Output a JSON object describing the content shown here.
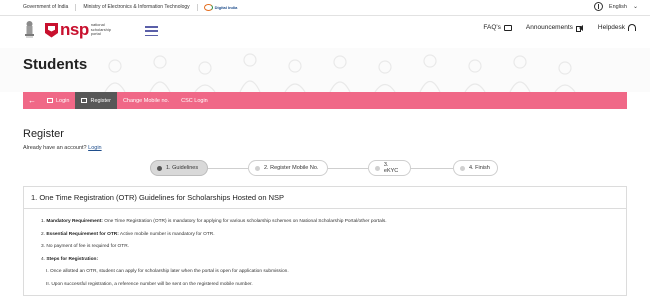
{
  "gov_strip": {
    "government": "Government of India",
    "ministry": "Ministry of Electronics & Information Technology",
    "digital_india": "Digital India",
    "language": "English"
  },
  "header": {
    "logo_text": "nsp",
    "logo_sub": "national scholarship portal",
    "nav": [
      {
        "label": "FAQ's",
        "icon": "chat-icon"
      },
      {
        "label": "Announcements",
        "icon": "megaphone-icon"
      },
      {
        "label": "Helpdesk",
        "icon": "headset-icon"
      }
    ]
  },
  "page_title": "Students",
  "tabs": [
    {
      "label": "Login"
    },
    {
      "label": "Register"
    },
    {
      "label": "Change Mobile no."
    },
    {
      "label": "CSC Login"
    }
  ],
  "register": {
    "title": "Register",
    "already_text": "Already have an account?",
    "login_link": "Login"
  },
  "steps": [
    {
      "label": "1. Guidelines"
    },
    {
      "label": "2. Register Mobile No."
    },
    {
      "label": "3. eKYC"
    },
    {
      "label": "4. Finish"
    }
  ],
  "guidelines": {
    "heading": "1. One Time Registration (OTR) Guidelines for Scholarships Hosted on NSP",
    "items": [
      {
        "num": "1.",
        "bold": "Mandatory Requirement:",
        "text": " One Time Registration (OTR) is mandatory for applying for various scholarship schemes on National Scholarship Portal/other portals."
      },
      {
        "num": "2.",
        "bold": "Essential Requirement for OTR:",
        "text": " Active mobile number is mandatory for OTR."
      },
      {
        "num": "3.",
        "bold": "",
        "text": "No payment of fee is required for OTR."
      },
      {
        "num": "4.",
        "bold": "Steps for Registration:",
        "text": ""
      }
    ],
    "sub_items": [
      {
        "num": "I.",
        "text": "Once allotted an OTR, student can apply for scholarship later when the portal is open for application submission."
      },
      {
        "num": "II.",
        "text": "Upon successful registration, a reference number will be sent on the registered mobile number."
      }
    ]
  },
  "colors": {
    "brand_red": "#c8102e",
    "tab_pink": "#f06887",
    "tab_active": "#575757",
    "link_blue": "#1f4e8c"
  }
}
